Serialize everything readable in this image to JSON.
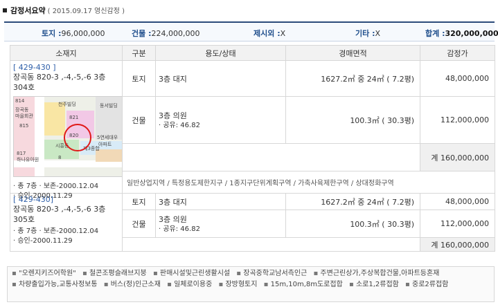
{
  "header": {
    "title": "감정서요약",
    "subtitle": "( 2015.09.17  영신감정 )"
  },
  "summary": {
    "land_label": "토지 :",
    "land_value": "96,000,000",
    "building_label": "건물 :",
    "building_value": "224,000,000",
    "excluded_label": "제시외 :",
    "excluded_value": "X",
    "other_label": "기타 :",
    "other_value": "X",
    "total_label": "합계 :",
    "total_value": "320,000,000"
  },
  "columns": [
    "소재지",
    "구분",
    "용도/상태",
    "경매면적",
    "감정가"
  ],
  "units": [
    {
      "code": "[ 429-430 ]",
      "address_line1": "장곡동 820-3 ,-4,-5,-6 3층",
      "address_line2": "304호",
      "land_type": "토지",
      "land_use": "3층 대지",
      "land_area": "1627.2㎡ 중 24㎡   ( 7.2평)",
      "land_price": "48,000,000",
      "bldg_type": "건물",
      "bldg_use": "3층 의원",
      "bldg_share": "· 공유: 46.82",
      "bldg_area": "100.3㎡   ( 30.3평)",
      "bldg_price": "112,000,000",
      "subtotal": "계 160,000,000",
      "floors": "· 총 7층  · 보존-2000.12.04",
      "approval": "· 승인-2000.11.29",
      "zoning": "일반상업지역 / 특정용도제한지구 / 1종지구단위계획구역 / 가축사육제한구역 / 상대정화구역"
    },
    {
      "code": "[ 429-430]",
      "address_line1": "장곡동 820-3 ,-4,-5,-6 3층",
      "address_line2": "305호",
      "floors": "· 총 7층  · 보존-2000.12.04",
      "approval": "· 승인-2000.11.29",
      "land_type": "토지",
      "land_use": "3층 대지",
      "land_area": "1627.2㎡ 중 24㎡   ( 7.2평)",
      "land_price": "48,000,000",
      "bldg_type": "건물",
      "bldg_use": "3층 의원",
      "bldg_share": "· 공유: 46.82",
      "bldg_area": "100.3㎡   ( 30.3평)",
      "bldg_price": "112,000,000",
      "subtotal": "계 160,000,000"
    }
  ],
  "map_labels": {
    "a": "장곡동",
    "b": "마을회관",
    "c": "814",
    "d": "815",
    "e": "동서빌딩",
    "f": "821",
    "g": "820",
    "h": "5연세대우",
    "i": "아파트",
    "j": "제3종합",
    "k": "시흥동",
    "l": "817",
    "m": "하나유아원",
    "n": "8",
    "o": "천주빌딩"
  },
  "features": [
    "\"오렌지키즈어학원\"",
    "철콘조평슬래브지붕",
    "판매시설및근린생활시설",
    "장곡중학교남서측인근",
    "주변근린상가,주상복합건물,아파트등혼재",
    "차량출입가능,교통사정보통",
    "버스(정)인근소재",
    "일체로이용중",
    "장방형토지",
    "15m,10m,8m도로접합",
    "소로1,2류접함",
    "중로2류접함"
  ]
}
